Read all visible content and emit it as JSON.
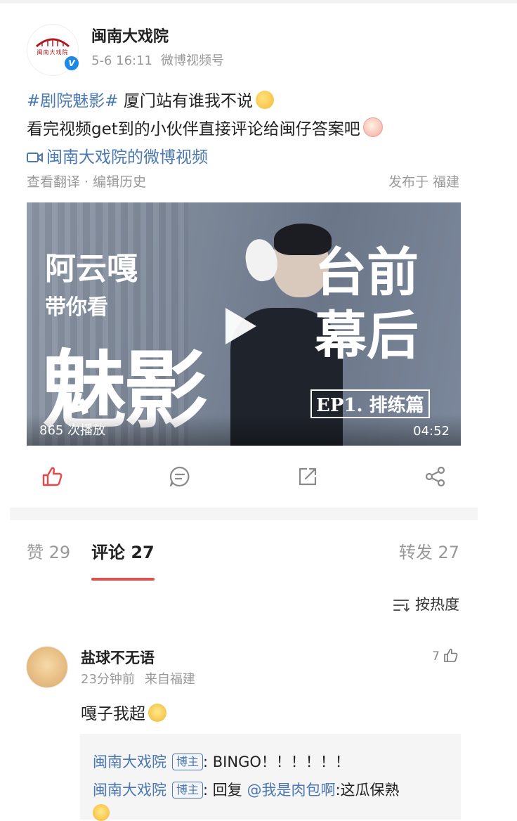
{
  "post": {
    "author_name": "闽南大戏院",
    "avatar_logo_text": "闽南大戏院",
    "date": "5-6 16:11",
    "source": "微博视频号",
    "topic": "#剧院魅影#",
    "line1_text": " 厦门站有谁我不说",
    "line2_text": "看完视频get到的小伙伴直接评论给闽仔答案吧",
    "video_link": "闽南大戏院的微博视频",
    "translate": "查看翻译 · 编辑历史",
    "location": "发布于 福建"
  },
  "video": {
    "overlay_line1": "阿云嘎",
    "overlay_line2": "带你看",
    "overlay_big": "魅影",
    "overlay_right1": "台前",
    "overlay_right2": "幕后",
    "overlay_episode": "EP1. 排练篇",
    "views": "865 次播放",
    "duration": "04:52"
  },
  "actions": {
    "like_color": "#e5474a",
    "icon_color": "#8a8a8a"
  },
  "tabs": {
    "likes": "赞 29",
    "comments": "评论 27",
    "reposts": "转发 27",
    "sort": "按热度"
  },
  "comment": {
    "name": "盐球不无语",
    "time": "23分钟前",
    "from": "来自福建",
    "likes": "7",
    "text": "嘎子我超",
    "replies": [
      {
        "name": "闽南大戏院",
        "badge": "博主",
        "text": ": BINGO！！！！！！"
      },
      {
        "name": "闽南大戏院",
        "badge": "博主",
        "prefix": ": 回复 ",
        "mention": "@我是肉包啊",
        "text": ":这瓜保熟"
      }
    ]
  }
}
